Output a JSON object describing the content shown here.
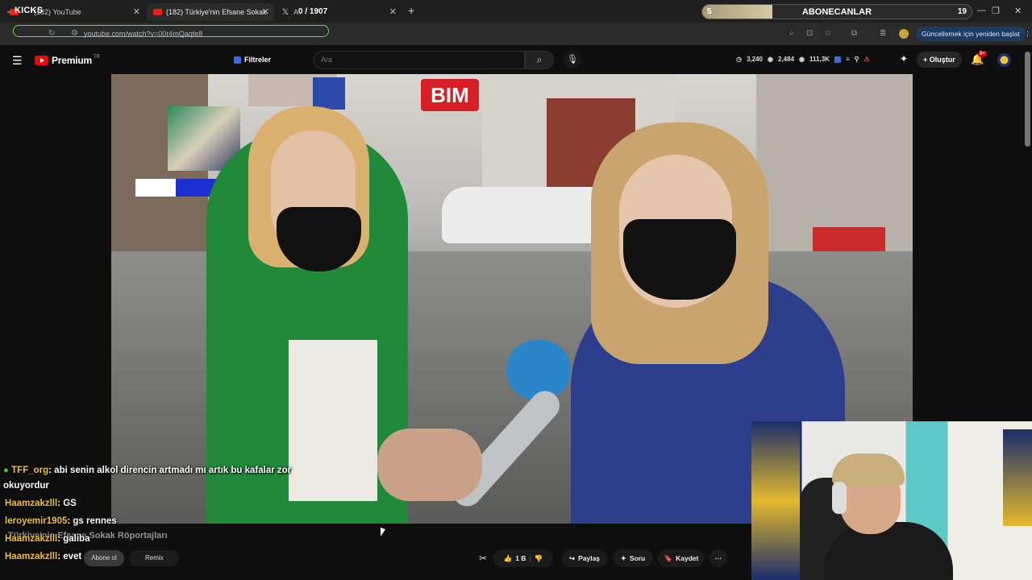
{
  "browser": {
    "tabs": [
      {
        "label": "(182) YouTube"
      },
      {
        "label": "(182) Türkiye'nin Efsane Sokak"
      },
      {
        "label": "A"
      }
    ],
    "new_tab": "+",
    "url": "youtube.com/watch?v=00r4mQaqfe8",
    "update_button": "Güncellemek için yeniden başlat",
    "window_controls": [
      "—",
      "❐",
      "✕"
    ]
  },
  "stream_overlay": {
    "kicks_label": "KICKS",
    "kicks_count": "0 / 1907",
    "sub_goal": {
      "label": "ABONECANLAR",
      "current": "5",
      "goal": "19",
      "progress": 0.26
    }
  },
  "youtube": {
    "logo_text": "Premium",
    "country": "TR",
    "filters_label": "Filtreler",
    "search_placeholder": "Ara",
    "stats": [
      "3,240",
      "2,484",
      "111,3K"
    ],
    "create_label": "Oluştur",
    "notifications_badge": "9+",
    "video_title": "Türkiye'nin Efsane Sokak Röportajları",
    "subscribe_label": "Abone ol",
    "remix_label": "Remix",
    "actions": {
      "likes": "1 B",
      "share": "Paylaş",
      "ask": "Soru",
      "save": "Kaydet",
      "more": "···"
    },
    "video_sign": "BIM"
  },
  "chat": [
    {
      "user": "TFF_org",
      "text": ": abi senin alkol direncin artmadı mı artık bu kafalar zor",
      "continuation": "okuyordur",
      "color": "#f2c12e"
    },
    {
      "user": "Haamzakzlll",
      "text": ": GS",
      "color": "#f2c12e"
    },
    {
      "user": "leroyemir1905",
      "text": ": gs rennes",
      "color": "#f2c12e"
    },
    {
      "user": "Haamzakzlll",
      "text": ": galiba",
      "color": "#f2c12e"
    },
    {
      "user": "Haamzakzlll",
      "text": ": evet",
      "color": "#f2c12e"
    }
  ],
  "colors": {
    "accent_green": "#6dd64f",
    "youtube_red": "#ff0000",
    "chat_username": "#f2c12e"
  }
}
